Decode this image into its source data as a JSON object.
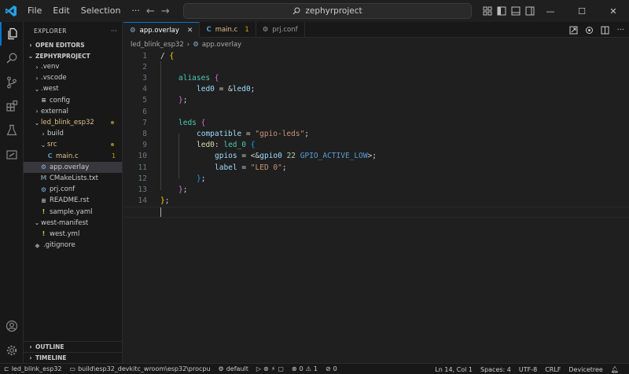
{
  "menu": {
    "file": "File",
    "edit": "Edit",
    "selection": "Selection",
    "more": "···"
  },
  "command_center": {
    "text": "zephyrproject"
  },
  "window_controls": {
    "minimize": "—",
    "maximize": "☐",
    "close": "✕"
  },
  "sidebar": {
    "title": "EXPLORER",
    "more": "···",
    "open_editors": "OPEN EDITORS",
    "project": "ZEPHYRPROJECT",
    "outline": "OUTLINE",
    "timeline": "TIMELINE",
    "tree": [
      {
        "label": ".venv",
        "chev": "›",
        "icon": "",
        "indent": 1
      },
      {
        "label": ".vscode",
        "chev": "›",
        "icon": "",
        "indent": 1
      },
      {
        "label": ".west",
        "chev": "⌄",
        "icon": "",
        "indent": 1
      },
      {
        "label": "config",
        "chev": "",
        "icon": "≡",
        "indent": 2
      },
      {
        "label": "external",
        "chev": "›",
        "icon": "",
        "indent": 1
      },
      {
        "label": "led_blink_esp32",
        "chev": "⌄",
        "icon": "",
        "indent": 1
      },
      {
        "label": "build",
        "chev": "›",
        "icon": "",
        "indent": 2
      },
      {
        "label": "src",
        "chev": "⌄",
        "icon": "",
        "indent": 2
      },
      {
        "label": "main.c",
        "chev": "",
        "icon": "C",
        "indent": 3,
        "badge": "1"
      },
      {
        "label": "app.overlay",
        "chev": "",
        "icon": "⚙",
        "indent": 2
      },
      {
        "label": "CMakeLists.txt",
        "chev": "",
        "icon": "M",
        "indent": 2
      },
      {
        "label": "prj.conf",
        "chev": "",
        "icon": "⚙",
        "indent": 2
      },
      {
        "label": "README.rst",
        "chev": "",
        "icon": "≡",
        "indent": 2
      },
      {
        "label": "sample.yaml",
        "chev": "",
        "icon": "!",
        "indent": 2
      },
      {
        "label": "west-manifest",
        "chev": "⌄",
        "icon": "",
        "indent": 1
      },
      {
        "label": "west.yml",
        "chev": "",
        "icon": "!",
        "indent": 2
      },
      {
        "label": ".gitignore",
        "chev": "",
        "icon": "◆",
        "indent": 1
      }
    ]
  },
  "tabs": [
    {
      "label": "app.overlay",
      "icon": "⚙",
      "close": "✕"
    },
    {
      "label": "main.c",
      "icon": "C",
      "badge": "1"
    },
    {
      "label": "prj.conf",
      "icon": "⚙"
    }
  ],
  "breadcrumb": {
    "folder": "led_blink_esp32",
    "sep": "›",
    "file": "app.overlay"
  },
  "code": {
    "line_numbers": [
      "1",
      "2",
      "3",
      "4",
      "5",
      "6",
      "7",
      "8",
      "9",
      "10",
      "11",
      "12",
      "13",
      "14"
    ],
    "l1": {
      "a": "/ ",
      "b": "{"
    },
    "l2": "",
    "l3": {
      "a": "aliases ",
      "b": "{"
    },
    "l4": {
      "a": "led0",
      "b": " = &",
      "c": "led0",
      "d": ";"
    },
    "l5": {
      "a": "}",
      "b": ";"
    },
    "l6": "",
    "l7": {
      "a": "leds ",
      "b": "{"
    },
    "l8": {
      "a": "compatible",
      "b": " = ",
      "c": "\"gpio-leds\"",
      "d": ";"
    },
    "l9": {
      "a": "led0",
      "b": ": ",
      "c": "led_0",
      "d": " ",
      "e": "{"
    },
    "l10": {
      "a": "gpios",
      "b": " = <&",
      "c": "gpio0",
      "d": " ",
      "e": "22",
      "f": " ",
      "g": "GPIO_ACTIVE_LOW",
      "h": ">;"
    },
    "l11": {
      "a": "label",
      "b": " = ",
      "c": "\"LED 0\"",
      "d": ";"
    },
    "l12": {
      "a": "}",
      "b": ";"
    },
    "l13": {
      "a": "}",
      "b": ";"
    },
    "l14": {
      "a": "}",
      "b": ";"
    }
  },
  "statusbar": {
    "branch": "led_blink_esp32",
    "build": "build\\esp32_devkitc_wroom\\esp32\\procpu",
    "default": "default",
    "errors": "0",
    "warnings": "1",
    "ports": "0",
    "position": "Ln 14, Col 1",
    "spaces": "Spaces: 4",
    "encoding": "UTF-8",
    "eol": "CRLF",
    "language": "Devicetree"
  },
  "colors": {
    "accent": "#0078d4",
    "warning": "#cca700",
    "modified": "#e2c08d"
  }
}
